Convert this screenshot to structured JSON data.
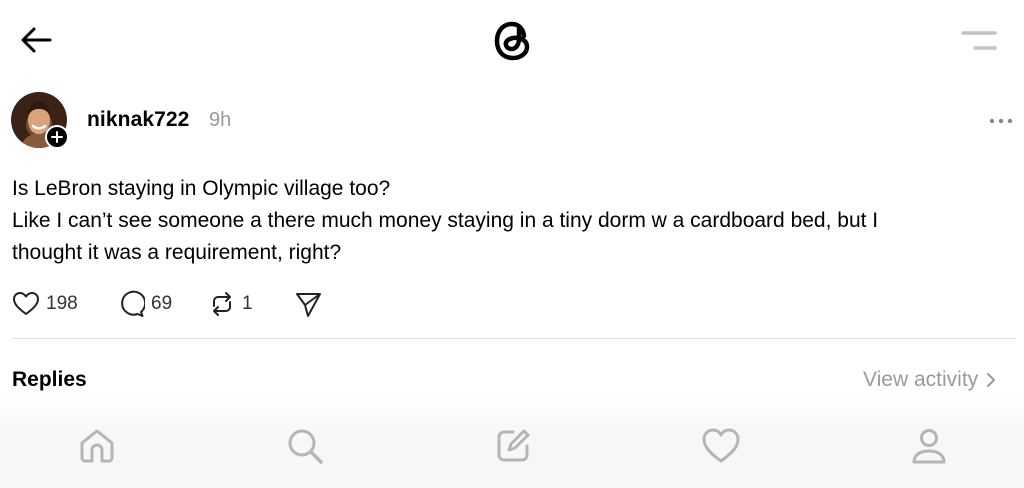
{
  "header": {
    "back_icon": "arrow-left-icon",
    "logo_icon": "threads-logo-icon",
    "menu_icon": "menu-lines-icon"
  },
  "post": {
    "username": "niknak722",
    "time": "9h",
    "avatar_icon": "avatar",
    "follow_icon": "plus-icon",
    "more_icon": "ellipsis-icon",
    "text_lines": [
      "Is LeBron staying in Olympic village too?",
      "Like I can’t see someone a there much money staying in a tiny dorm w a cardboard bed, but I",
      "thought it was a requirement, right?"
    ],
    "actions": {
      "likes": "198",
      "replies": "69",
      "reposts": "1"
    }
  },
  "replies_section": {
    "title": "Replies",
    "view_activity": "View activity"
  },
  "bottom_nav": [
    "home-icon",
    "search-icon",
    "compose-icon",
    "heart-icon",
    "profile-icon"
  ],
  "colors": {
    "text": "#000000",
    "muted": "#9a9a9a",
    "icon_muted": "#b5b5b5",
    "divider": "#e2e2e2"
  }
}
